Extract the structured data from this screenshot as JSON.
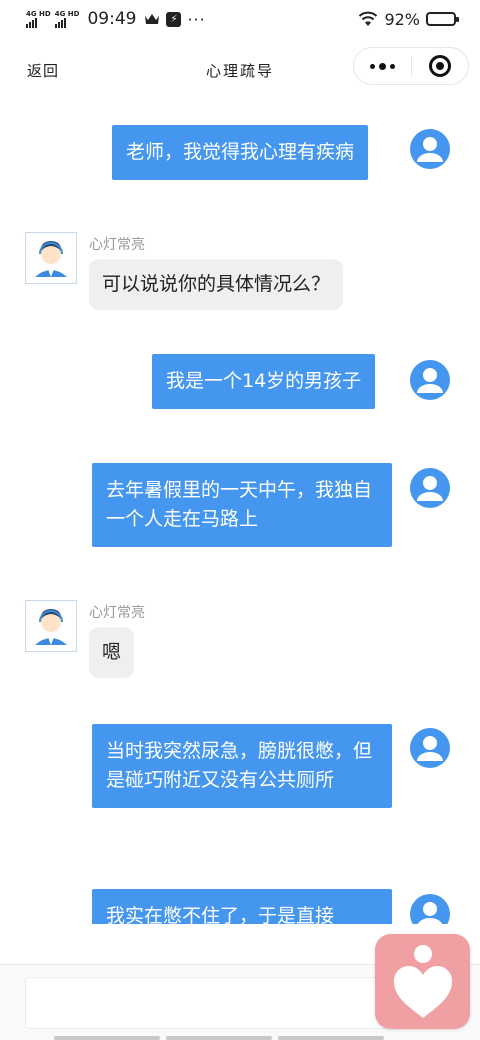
{
  "status_bar": {
    "network_1": "4G HD",
    "network_2": "4G HD",
    "time": "09:49",
    "battery": "92%",
    "battery_level": 0.92,
    "icons": [
      "crown-icon",
      "app-icon",
      "more-dots-icon",
      "wifi-icon",
      "battery-icon"
    ]
  },
  "nav": {
    "back_label": "返回",
    "title": "心理疏导",
    "capsule_icons": [
      "more-icon",
      "close-target-icon"
    ]
  },
  "messages": [
    {
      "from": "user",
      "text": "老师，我觉得我心理有疾病"
    },
    {
      "from": "bot",
      "name": "心灯常亮",
      "text": "可以说说你的具体情况么？"
    },
    {
      "from": "user",
      "text": "我是一个14岁的男孩子"
    },
    {
      "from": "user",
      "text": "去年暑假里的一天中午，我独自一个人走在马路上"
    },
    {
      "from": "bot",
      "name": "心灯常亮",
      "text": "嗯"
    },
    {
      "from": "user",
      "text": "当时我突然尿急，膀胱很憋，但是碰巧附近又没有公共厕所"
    },
    {
      "from": "user",
      "text": "我实在憋不住了，于是直接"
    }
  ],
  "input": {
    "placeholder": "",
    "value": ""
  },
  "colors": {
    "user_bubble": "#4596ee",
    "bot_bubble": "#efefef",
    "fab": "#f0a0a3"
  },
  "fab_icon": "heart-person-icon"
}
